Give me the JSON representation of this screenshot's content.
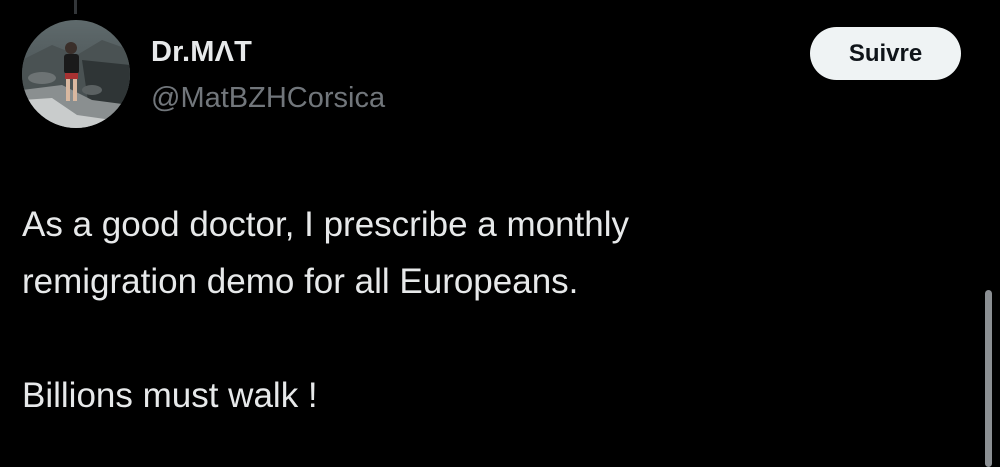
{
  "author": {
    "display_name": "Dr.MΛT",
    "handle": "@MatBZHCorsica"
  },
  "actions": {
    "follow_label": "Suivre"
  },
  "tweet": {
    "lines": [
      "As a good doctor, I prescribe a monthly",
      "remigration demo for all Europeans."
    ],
    "second_paragraph": "Billions must walk !"
  },
  "icons": {
    "avatar": "profile-photo",
    "thread": "thread-connector-line"
  },
  "colors": {
    "background": "#000000",
    "primary_text": "#e7e9ea",
    "secondary_text": "#71767b",
    "button_bg": "#eff3f4",
    "button_text": "#0f1419"
  }
}
